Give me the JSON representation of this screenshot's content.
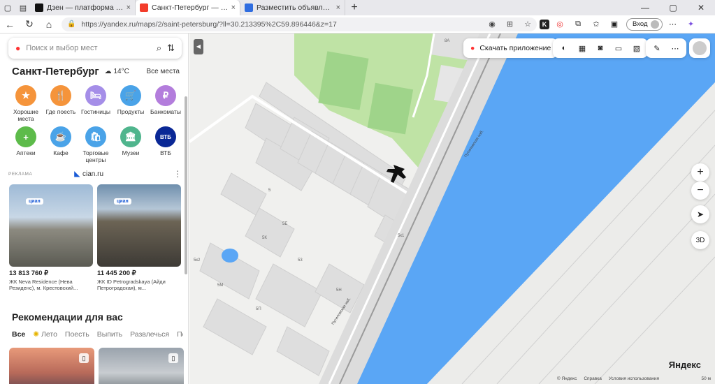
{
  "browser": {
    "tabs": [
      {
        "title": "Дзен — платформа для просмо",
        "close": "×",
        "icon_color": "#111111"
      },
      {
        "title": "Санкт-Петербург — Яндекс Карт",
        "close": "×",
        "icon_color": "#f33d2b"
      },
      {
        "title": "Разместить объявление о прод",
        "close": "×",
        "icon_color": "#2f6de0"
      }
    ],
    "new_tab": "+",
    "url": "https://yandex.ru/maps/2/saint-petersburg/?ll=30.213395%2C59.896446&z=17",
    "login_label": "Вход",
    "ext_k": "K"
  },
  "sidebar": {
    "search_placeholder": "Поиск и выбор мест",
    "city": "Санкт-Петербург",
    "weather": "14°C",
    "all_places": "Все места",
    "categories": [
      {
        "label": "Хорошие места",
        "color": "#f5943b",
        "icon": "★"
      },
      {
        "label": "Где поесть",
        "color": "#f5943b",
        "icon": "🍴"
      },
      {
        "label": "Гостиницы",
        "color": "#a58ee8",
        "icon": "🛏"
      },
      {
        "label": "Продукты",
        "color": "#4aa3e8",
        "icon": "🛒"
      },
      {
        "label": "Банкоматы",
        "color": "#b37ddc",
        "icon": "₽"
      },
      {
        "label": "Аптеки",
        "color": "#5dbb4a",
        "icon": "+"
      },
      {
        "label": "Кафе",
        "color": "#4aa3e8",
        "icon": "☕"
      },
      {
        "label": "Торговые центры",
        "color": "#4aa3e8",
        "icon": "🛍"
      },
      {
        "label": "Музеи",
        "color": "#4fb58d",
        "icon": "🏛"
      },
      {
        "label": "ВТБ",
        "color": "#0a2896",
        "icon": "ВТБ"
      }
    ],
    "ad": {
      "tag": "РЕКЛАМА",
      "source": "cian.ru",
      "more": "⋮",
      "items": [
        {
          "badge": "циан",
          "price": "13 813 760 ₽",
          "desc": "ЖК Neva Residence (Нева Резиденс), м. Крестовский..."
        },
        {
          "badge": "циан",
          "price": "11 445 200 ₽",
          "desc": "ЖК ID Petrogradskaya (Айди Петроградская), м..."
        }
      ]
    },
    "recommendations": {
      "title": "Рекомендации для вас",
      "tabs": [
        "Все",
        "Лето",
        "Поесть",
        "Выпить",
        "Развлечься",
        "По"
      ]
    }
  },
  "map": {
    "apps_label": "Скачать приложение",
    "zoom_in": "+",
    "zoom_out": "−",
    "btn_3d": "3D",
    "logo": "Яндекс",
    "copyright": [
      "© Яндекс",
      "Справка",
      "Условия использования"
    ],
    "scale": "50 м",
    "street": "Путиловская наб.",
    "buildings": [
      "8А",
      "5",
      "5Е",
      "5К",
      "5к1",
      "5к2",
      "53",
      "5М",
      "5Н",
      "5П"
    ],
    "colors": {
      "water": "#5aa6f5",
      "park": "#bfe3a5",
      "building": "#e0e0e0",
      "road": "#ffffff",
      "rail": "#9a9a9a"
    }
  }
}
